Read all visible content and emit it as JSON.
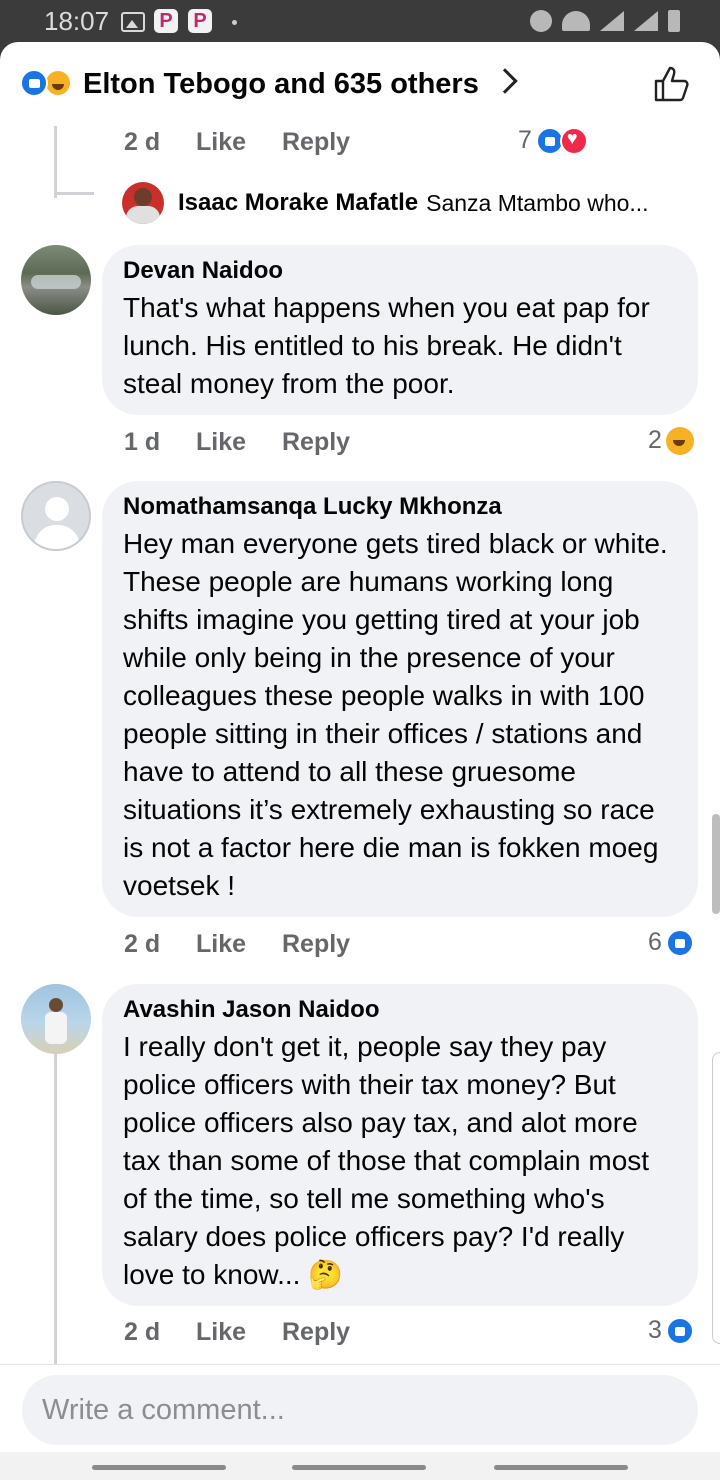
{
  "status_bar": {
    "time": "18:07"
  },
  "header": {
    "title": "Elton Tebogo and 635 others"
  },
  "comments": [
    {
      "time": "2 d",
      "like": "Like",
      "reply": "Reply",
      "reactions": "7"
    },
    {
      "name": "Devan Naidoo",
      "text": "That's what happens when you eat pap for lunch. His entitled to his break. He didn't steal money from the poor.",
      "time": "1 d",
      "like": "Like",
      "reply": "Reply",
      "reactions": "2"
    },
    {
      "name": "Nomathamsanqa Lucky Mkhonza",
      "text": "Hey man everyone gets tired black or white. These people are humans working long shifts imagine you getting tired at your job while only being in the presence of your colleagues these people walks in with 100 people sitting in their offices / stations and have to attend to all these gruesome situations it’s extremely exhausting so race is not a factor here die man is fokken moeg voetsek !",
      "time": "2 d",
      "like": "Like",
      "reply": "Reply",
      "reactions": "6"
    },
    {
      "name": "Avashin Jason Naidoo",
      "text": "I really don't get it, people say they pay police officers with their tax money? But police officers also pay tax, and alot more tax than some of those that complain most of the time, so tell me something who's salary does police officers pay? I'd really love to know... 🤔",
      "time": "2 d",
      "like": "Like",
      "reply": "Reply",
      "reactions": "3"
    }
  ],
  "reply_preview": {
    "name": "Isaac Morake Mafatle",
    "text": "Sanza Mtambo  who..."
  },
  "composer": {
    "placeholder": "Write a comment..."
  },
  "colors": {
    "accent": "#1b74e4",
    "bubble": "#f0f2f5",
    "secondary_text": "#65676b"
  }
}
